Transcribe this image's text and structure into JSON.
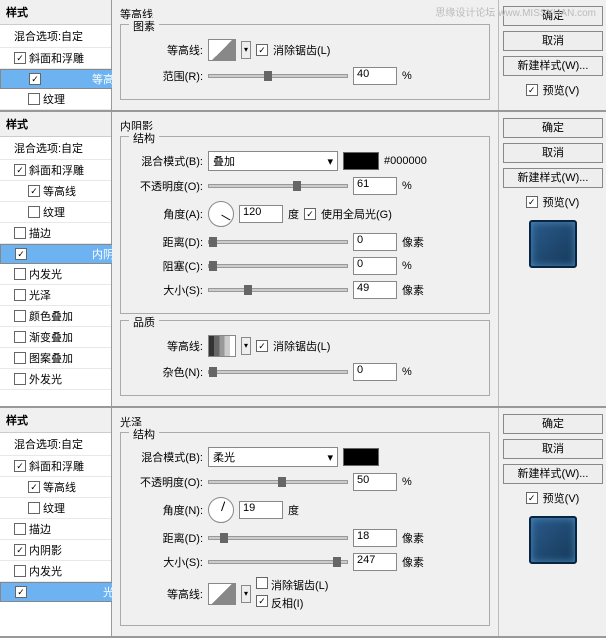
{
  "wm": "思缘设计论坛 www.MISSYUAN.com",
  "s": {
    "h": "样式",
    "blend": "混合选项:自定",
    "bevel": "斜面和浮雕",
    "contour": "等高线",
    "texture": "纹理",
    "stroke": "描边",
    "innerShadow": "内阴影",
    "innerGlow": "内发光",
    "satin": "光泽",
    "colorOverlay": "颜色叠加",
    "gradOverlay": "渐变叠加",
    "patOverlay": "图案叠加",
    "outerGlow": "外发光"
  },
  "btn": {
    "ok": "确定",
    "cancel": "取消",
    "new": "新建样式(W)...",
    "preview": "预览(V)"
  },
  "p1": {
    "title": "等高线",
    "grp": "图素",
    "contour": "等高线:",
    "aa": "消除锯齿(L)",
    "range": "范围(R):",
    "rangeV": "40",
    "pct": "%"
  },
  "p2": {
    "title": "内阴影",
    "g1": "结构",
    "blend": "混合模式(B):",
    "blendV": "叠加",
    "hex": "#000000",
    "op": "不透明度(O):",
    "opV": "61",
    "pct": "%",
    "ang": "角度(A):",
    "angV": "120",
    "deg": "度",
    "glob": "使用全局光(G)",
    "dist": "距离(D):",
    "distV": "0",
    "px": "像素",
    "choke": "阻塞(C):",
    "chokeV": "0",
    "size": "大小(S):",
    "sizeV": "49",
    "g2": "品质",
    "contour": "等高线:",
    "aa": "消除锯齿(L)",
    "noise": "杂色(N):",
    "noiseV": "0"
  },
  "p3": {
    "title": "光泽",
    "g1": "结构",
    "blend": "混合模式(B):",
    "blendV": "柔光",
    "op": "不透明度(O):",
    "opV": "50",
    "pct": "%",
    "ang": "角度(N):",
    "angV": "19",
    "deg": "度",
    "dist": "距离(D):",
    "distV": "18",
    "px": "像素",
    "size": "大小(S):",
    "sizeV": "247",
    "contour": "等高线:",
    "aa": "消除锯齿(L)",
    "inv": "反相(I)"
  }
}
